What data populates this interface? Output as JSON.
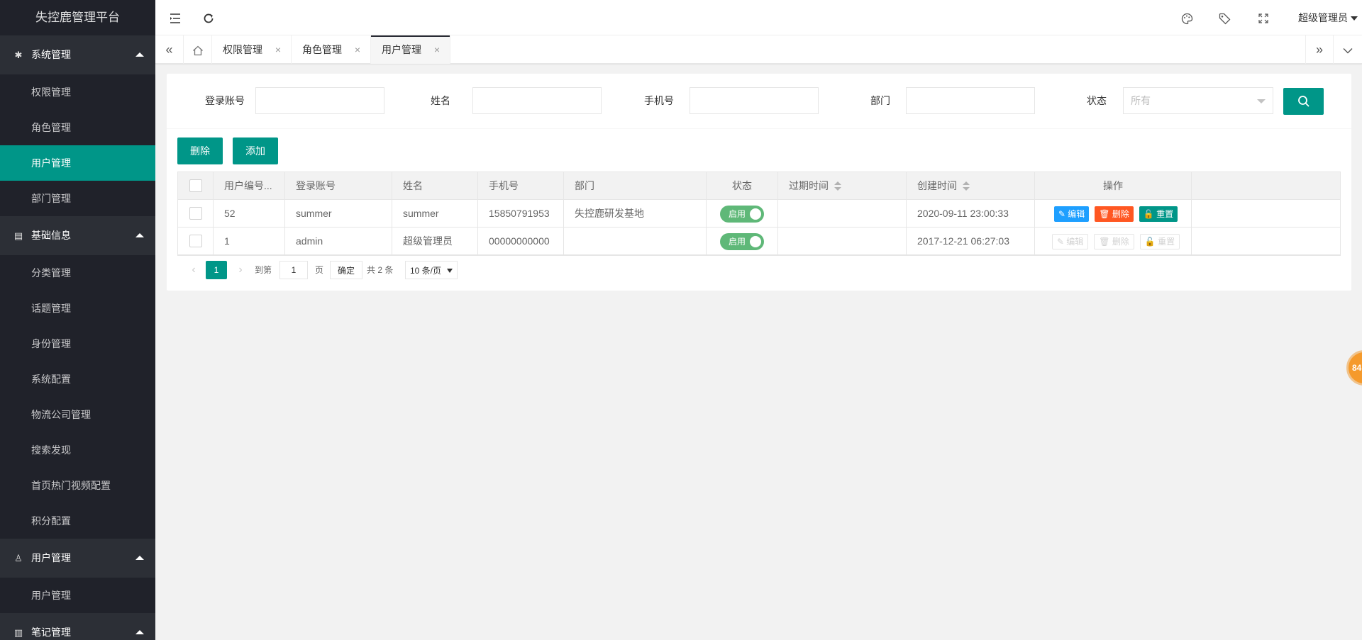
{
  "app": {
    "title": "失控鹿管理平台"
  },
  "header": {
    "user": "超级管理员"
  },
  "sidebar": {
    "groups": [
      {
        "title": "系统管理",
        "icon": "gear-icon",
        "items": [
          "权限管理",
          "角色管理",
          "用户管理",
          "部门管理"
        ]
      },
      {
        "title": "基础信息",
        "icon": "document-icon",
        "items": [
          "分类管理",
          "话题管理",
          "身份管理",
          "系统配置",
          "物流公司管理",
          "搜索发现",
          "首页热门视频配置",
          "积分配置"
        ]
      },
      {
        "title": "用户管理",
        "icon": "user-icon",
        "items": [
          "用户管理"
        ]
      },
      {
        "title": "笔记管理",
        "icon": "book-icon",
        "items": []
      }
    ]
  },
  "tabs": [
    {
      "label": "权限管理",
      "close": "×"
    },
    {
      "label": "角色管理",
      "close": "×"
    },
    {
      "label": "用户管理",
      "close": "×"
    }
  ],
  "search": {
    "account_label": "登录账号",
    "name_label": "姓名",
    "phone_label": "手机号",
    "dept_label": "部门",
    "status_label": "状态",
    "status_placeholder": "所有"
  },
  "toolbar": {
    "delete_label": "删除",
    "add_label": "添加"
  },
  "table": {
    "columns": [
      "用户编号...",
      "登录账号",
      "姓名",
      "手机号",
      "部门",
      "状态",
      "过期时间",
      "创建时间",
      "操作"
    ],
    "rows": [
      {
        "id": "52",
        "account": "summer",
        "name": "summer",
        "phone": "15850791953",
        "dept": "失控鹿研发基地",
        "status": "启用",
        "expire": "",
        "created": "2020-09-11 23:00:33"
      },
      {
        "id": "1",
        "account": "admin",
        "name": "超级管理员",
        "phone": "00000000000",
        "dept": "",
        "status": "启用",
        "expire": "",
        "created": "2017-12-21 06:27:03"
      }
    ],
    "actions": {
      "edit": "编辑",
      "delete": "删除",
      "reset": "重置"
    }
  },
  "pager": {
    "current": "1",
    "goto_label": "到第",
    "page_input": "1",
    "page_unit": "页",
    "ok": "确定",
    "total": "共 2 条",
    "size": "10 条/页"
  },
  "float_badge": "84",
  "colors": {
    "primary": "#009688",
    "sidebar": "#20222a",
    "edit": "#1e9fff",
    "danger": "#ff5722",
    "switch_on": "#5fb878"
  }
}
